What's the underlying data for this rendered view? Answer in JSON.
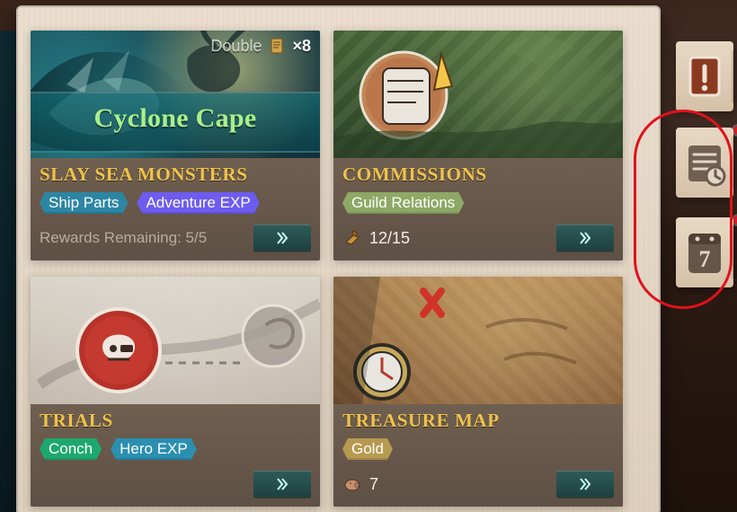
{
  "colors": {
    "title": "#f0c24b",
    "tag_ship_parts": "#2c86a3",
    "tag_adventure_exp": "#6d5cf0",
    "tag_guild_relations": "#8ea866",
    "tag_conch": "#1ea86f",
    "tag_hero_exp": "#2b8fb0",
    "tag_gold": "#b69a51",
    "go_button": "#2a5553",
    "highlight": "#e0121b",
    "badge": "#d11f25"
  },
  "cards": [
    {
      "id": "slay_sea_monsters",
      "title": "SLAY SEA MONSTERS",
      "banner_title": "Cyclone Cape",
      "double_label": "Double",
      "double_count": "×8",
      "tags": [
        {
          "label": "Ship Parts",
          "color_key": "tag_ship_parts"
        },
        {
          "label": "Adventure EXP",
          "color_key": "tag_adventure_exp"
        }
      ],
      "meta": {
        "text": "Rewards Remaining: 5/5"
      }
    },
    {
      "id": "commissions",
      "title": "COMMISSIONS",
      "tags": [
        {
          "label": "Guild Relations",
          "color_key": "tag_guild_relations"
        }
      ],
      "meta": {
        "icon": "horn-icon",
        "text": "12/15"
      }
    },
    {
      "id": "trials",
      "title": "TRIALS",
      "tags": [
        {
          "label": "Conch",
          "color_key": "tag_conch"
        },
        {
          "label": "Hero EXP",
          "color_key": "tag_hero_exp"
        }
      ],
      "meta": {
        "text": ""
      }
    },
    {
      "id": "treasure_map",
      "title": "TREASURE MAP",
      "tags": [
        {
          "label": "Gold",
          "color_key": "tag_gold"
        }
      ],
      "meta": {
        "icon": "pig-icon",
        "text": "7"
      }
    }
  ],
  "icons": {
    "go": "double-chevron-right-icon",
    "double": "scroll-icon",
    "tab_1": "alert-scroll-icon",
    "tab_2": "scroll-clock-icon",
    "tab_3": "calendar-7-icon"
  },
  "side_tabs": [
    {
      "id": "tab_1",
      "calendar_day": "",
      "has_badge": false
    },
    {
      "id": "tab_2",
      "calendar_day": "",
      "has_badge": true
    },
    {
      "id": "tab_3",
      "calendar_day": "7",
      "has_badge": true
    }
  ]
}
